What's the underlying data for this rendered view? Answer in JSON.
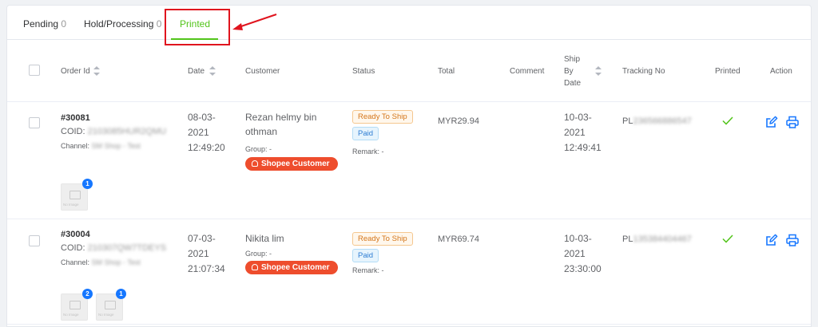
{
  "tabs": [
    {
      "label": "Pending",
      "count": "0"
    },
    {
      "label": "Hold/Processing",
      "count": "0"
    },
    {
      "label": "Printed",
      "count": ""
    }
  ],
  "colors": {
    "accent": "#52c41a",
    "highlight": "#e0141e",
    "shopee": "#ee4d2d",
    "badge": "#1677ff"
  },
  "columns": {
    "order_id": "Order Id",
    "date": "Date",
    "customer": "Customer",
    "status": "Status",
    "total": "Total",
    "comment": "Comment",
    "ship_by_1": "Ship",
    "ship_by_2": "By",
    "ship_by_3": "Date",
    "tracking": "Tracking No",
    "printed": "Printed",
    "action": "Action"
  },
  "orders": [
    {
      "order_no": "#30081",
      "coid_label": "COID:",
      "coid_value": "2103085HUR2QMU",
      "channel_label": "Channel:",
      "channel_value": "SM Shop - Test",
      "date_1": "08-03-",
      "date_2": "2021",
      "date_3": "12:49:20",
      "customer_1": "Rezan helmy bin",
      "customer_2": "othman",
      "group": "Group: -",
      "customer_tag": "Shopee Customer",
      "status_ship": "Ready To Ship",
      "status_paid": "Paid",
      "remark": "Remark: -",
      "total": "MYR29.94",
      "ship_1": "10-03-",
      "ship_2": "2021",
      "ship_3": "12:49:41",
      "tracking_prefix": "PL",
      "tracking_rest": "236566886547",
      "thumbs": [
        {
          "badge": "1",
          "text": "No Image"
        }
      ]
    },
    {
      "order_no": "#30004",
      "coid_label": "COID:",
      "coid_value": "210307QW7TDEYS",
      "channel_label": "Channel:",
      "channel_value": "SM Shop - Test",
      "date_1": "07-03-",
      "date_2": "2021",
      "date_3": "21:07:34",
      "customer_1": "Nikita lim",
      "customer_2": "",
      "group": "Group: -",
      "customer_tag": "Shopee Customer",
      "status_ship": "Ready To Ship",
      "status_paid": "Paid",
      "remark": "Remark: -",
      "total": "MYR69.74",
      "ship_1": "10-03-",
      "ship_2": "2021",
      "ship_3": "23:30:00",
      "tracking_prefix": "PL",
      "tracking_rest": "135384404467",
      "thumbs": [
        {
          "badge": "2",
          "text": "No Image"
        },
        {
          "badge": "1",
          "text": "No Image"
        }
      ]
    }
  ]
}
